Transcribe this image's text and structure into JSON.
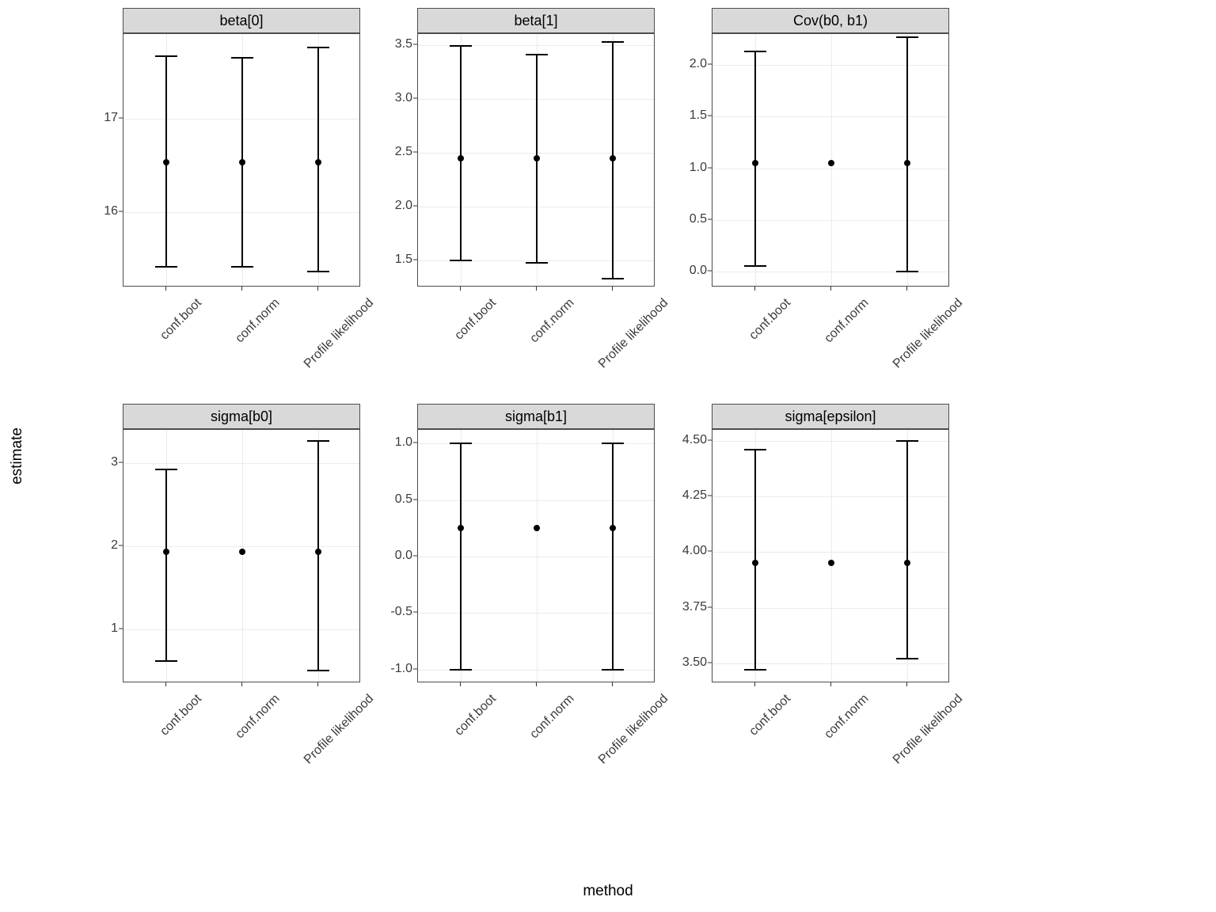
{
  "xlabel": "method",
  "ylabel": "estimate",
  "methods": [
    "conf.boot",
    "conf.norm",
    "Profile likelihood"
  ],
  "chart_data": [
    {
      "title": "beta[0]",
      "type": "pointrange",
      "ylim": [
        15.2,
        17.9
      ],
      "y_ticks": [
        16,
        17
      ],
      "series": [
        {
          "method": "conf.boot",
          "estimate": 16.53,
          "low": 15.42,
          "high": 17.66
        },
        {
          "method": "conf.norm",
          "estimate": 16.53,
          "low": 15.42,
          "high": 17.65
        },
        {
          "method": "Profile likelihood",
          "estimate": 16.53,
          "low": 15.37,
          "high": 17.76
        }
      ]
    },
    {
      "title": "beta[1]",
      "type": "pointrange",
      "ylim": [
        1.25,
        3.6
      ],
      "y_ticks": [
        1.5,
        2.0,
        2.5,
        3.0,
        3.5
      ],
      "series": [
        {
          "method": "conf.boot",
          "estimate": 2.45,
          "low": 1.5,
          "high": 3.49
        },
        {
          "method": "conf.norm",
          "estimate": 2.45,
          "low": 1.48,
          "high": 3.41
        },
        {
          "method": "Profile likelihood",
          "estimate": 2.45,
          "low": 1.33,
          "high": 3.53
        }
      ]
    },
    {
      "title": "Cov(b0, b1)",
      "type": "pointrange",
      "ylim": [
        -0.15,
        2.3
      ],
      "y_ticks": [
        0.0,
        0.5,
        1.0,
        1.5,
        2.0
      ],
      "series": [
        {
          "method": "conf.boot",
          "estimate": 1.05,
          "low": 0.06,
          "high": 2.13
        },
        {
          "method": "conf.norm",
          "estimate": 1.05,
          "low": null,
          "high": null
        },
        {
          "method": "Profile likelihood",
          "estimate": 1.05,
          "low": 0.0,
          "high": 2.27
        }
      ]
    },
    {
      "title": "sigma[b0]",
      "type": "pointrange",
      "ylim": [
        0.35,
        3.4
      ],
      "y_ticks": [
        1,
        2,
        3
      ],
      "series": [
        {
          "method": "conf.boot",
          "estimate": 1.93,
          "low": 0.62,
          "high": 2.92
        },
        {
          "method": "conf.norm",
          "estimate": 1.93,
          "low": null,
          "high": null
        },
        {
          "method": "Profile likelihood",
          "estimate": 1.93,
          "low": 0.5,
          "high": 3.27
        }
      ]
    },
    {
      "title": "sigma[b1]",
      "type": "pointrange",
      "ylim": [
        -1.12,
        1.12
      ],
      "y_ticks": [
        -1.0,
        -0.5,
        0.0,
        0.5,
        1.0
      ],
      "series": [
        {
          "method": "conf.boot",
          "estimate": 0.25,
          "low": -1.0,
          "high": 1.0
        },
        {
          "method": "conf.norm",
          "estimate": 0.25,
          "low": null,
          "high": null
        },
        {
          "method": "Profile likelihood",
          "estimate": 0.25,
          "low": -1.0,
          "high": 1.0
        }
      ]
    },
    {
      "title": "sigma[epsilon]",
      "type": "pointrange",
      "ylim": [
        3.41,
        4.55
      ],
      "y_ticks": [
        3.5,
        3.75,
        4.0,
        4.25,
        4.5
      ],
      "series": [
        {
          "method": "conf.boot",
          "estimate": 3.95,
          "low": 3.47,
          "high": 4.46
        },
        {
          "method": "conf.norm",
          "estimate": 3.95,
          "low": null,
          "high": null
        },
        {
          "method": "Profile likelihood",
          "estimate": 3.95,
          "low": 3.52,
          "high": 4.5
        }
      ]
    }
  ]
}
